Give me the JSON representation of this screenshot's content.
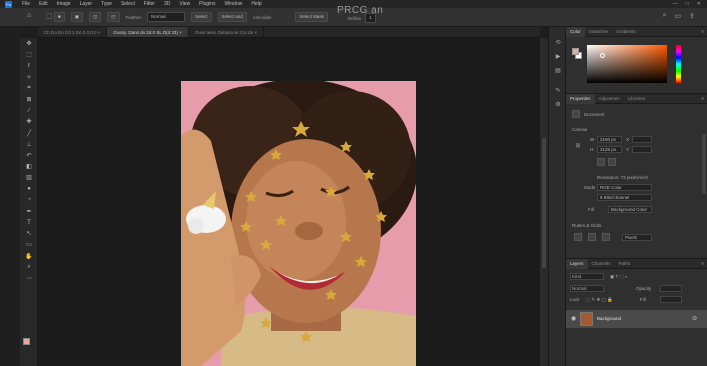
{
  "app": {
    "title": "PRCG an"
  },
  "menu": [
    "File",
    "Edit",
    "Image",
    "Layer",
    "Type",
    "Select",
    "Filter",
    "3D",
    "View",
    "Plugins",
    "Window",
    "Help"
  ],
  "window_controls": [
    "—",
    "□",
    "✕"
  ],
  "options_bar": {
    "feather_label": "Feather",
    "style_value": "Normal",
    "width_label": "Select",
    "height_label": "Select and",
    "antialias": "Anti-alias",
    "mask_button": "Select Mask",
    "refine_label": "Refine",
    "refine_value": "1"
  },
  "tabs": [
    {
      "label": "Ch Do Do Cd 1 Do 0.0 0.0 ×",
      "active": false
    },
    {
      "label": "Gossy. Dans do 2d 0 SL D(d 33) ×",
      "active": true
    },
    {
      "label": "Ouss aeso Dabaso te 2 to do ×",
      "active": false
    }
  ],
  "tools": [
    "move-icon",
    "marquee-icon",
    "lasso-icon",
    "quick-select-icon",
    "crop-icon",
    "frame-icon",
    "eyedropper-icon",
    "healing-icon",
    "brush-icon",
    "stamp-icon",
    "history-brush-icon",
    "eraser-icon",
    "gradient-icon",
    "blur-icon",
    "dodge-icon",
    "pen-icon",
    "type-icon",
    "path-select-icon",
    "shape-icon",
    "hand-icon",
    "zoom-icon",
    "more-icon"
  ],
  "color_panel": {
    "tabs": [
      "Color",
      "Swatches",
      "Gradients"
    ],
    "fg_color": "#e8a89a",
    "bg_color": "#ffffff"
  },
  "properties_panel": {
    "tabs": [
      "Properties",
      "Adjustmen",
      "Libraries"
    ],
    "doc_label": "Document",
    "section_canvas": "Canvas",
    "w_label": "W",
    "w_value": "2160 px",
    "x_label": "X",
    "h_label": "H",
    "h_value": "3125 px",
    "y_label": "Y",
    "resolution": "Resolution: 72 pixels/inch",
    "mode_label": "Mode",
    "mode_value": "RGB Color",
    "bit_value": "8 Bits/Channel",
    "fill_label": "Fill",
    "fill_value": "Background Color",
    "section_rulers": "Rulers & Grids",
    "units_value": "Pixels"
  },
  "layers_panel": {
    "tabs": [
      "Layers",
      "Channels",
      "Paths"
    ],
    "kind_label": "Kind",
    "mode_value": "Normal",
    "opacity_label": "Opacity",
    "lock_label": "Lock",
    "fill_label": "Fill",
    "layer_name": "Background"
  }
}
